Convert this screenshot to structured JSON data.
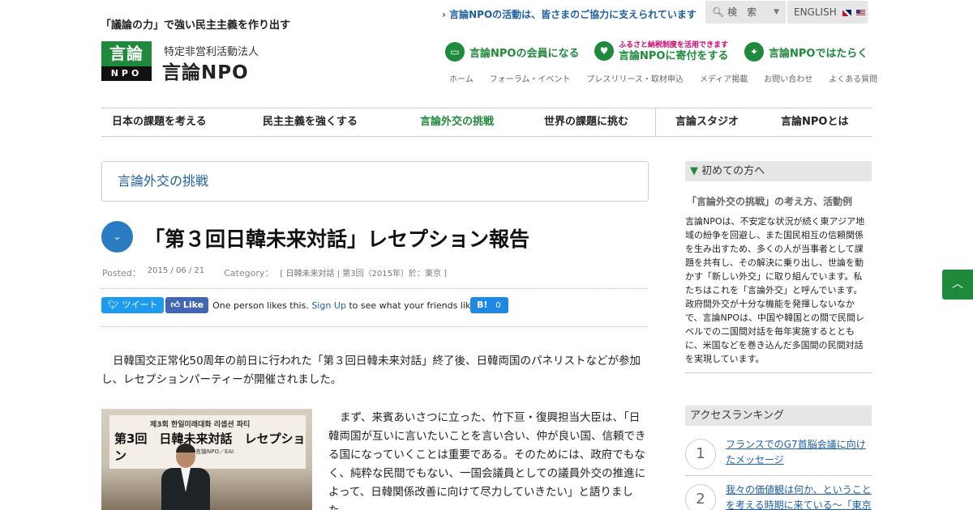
{
  "header": {
    "tagline": "「議論の力」で強い民主主義を作り出す",
    "logo_big": "言論",
    "logo_small": "NPO",
    "org_sub": "特定非営利活動法人",
    "org_name": "言論NPO",
    "support_text": "言論NPOの活動は、皆さまのご協力に支えられています",
    "search_label": "検　索",
    "lang_label": "ENGLISH",
    "actions": [
      {
        "label": "言論NPOの会員になる",
        "icon": "member-card-icon"
      },
      {
        "tiny": "ふるさと納税制度を活用できます",
        "label": "言論NPOに寄付をする",
        "icon": "heart-icon"
      },
      {
        "label": "言論NPOではたらく",
        "icon": "runner-icon"
      }
    ],
    "utility_links": [
      "ホーム",
      "フォーラム・イベント",
      "プレスリリース・取材申込",
      "メディア掲載",
      "お問い合わせ",
      "よくある質問"
    ]
  },
  "nav": {
    "items": [
      "日本の課題を考える",
      "民主主義を強くする",
      "言論外交の挑戦",
      "世界の課題に挑む",
      "言論スタジオ",
      "言論NPOとは"
    ],
    "active": "言論外交の挑戦"
  },
  "main": {
    "breadcrumb": "言論外交の挑戦",
    "title": "「第３回日韓未来対話」レセプション報告",
    "posted_label": "Posted：",
    "posted_value": "2015 / 06 / 21",
    "category_label": "Category：",
    "category_value": "[ 日韓未来対話 |  第3回（2015年）於：東京 ]",
    "tweet_label": "ツイート",
    "like_label": "Like",
    "fb_text": "One person likes this.",
    "fb_signup": "Sign Up",
    "fb_text2": "to see what your friends like.",
    "hatena_label": "B!",
    "hatena_count": "0",
    "para1": "日韓国交正常化50周年の前日に行われた「第３回日韓未来対話」終了後、日韓両国のパネリストなどが参加し、レセプションパーティーが開催されました。",
    "para2": "まず、来賓あいさつに立った、竹下亘・復興担当大臣は、「日韓両国が互いに言いたいことを言い合い、仲が良い国、信頼できる国になっていくことは重要である。そのためには、政府でもなく、純粋な民間でもない、一国会議員としての議員外交の推進によって、日韓関係改善に向けて尽力していきたい」と語りました。",
    "photo_banner_top": "제3회 한일미래대화 리셉션 파티",
    "photo_banner_main": "第3回　日韓未来対話　レセプション",
    "photo_banner_sub": "主催　言論NPO／EAI"
  },
  "sidebar": {
    "intro_heading": "初めての方へ",
    "intro_sub": "「言論外交の挑戦」の考え方、活動例",
    "intro_text": "言論NPOは、不安定な状況が続く東アジア地域の紛争を回避し、また国民相互の信頼関係を生み出すため、多くの人が当事者として課題を共有し、その解決に乗り出し、世論を動かす「新しい外交」に取り組んでいます。私たちはこれを「言論外交」と呼んでいます。政府間外交が十分な機能を発揮しないなかで、言論NPOは、中国や韓国との間で民間レベルでの二国間対話を毎年実施するとともに、米国などを巻き込んだ多国間の民間対話を実現しています。",
    "ranking_heading": "アクセスランキング",
    "ranking": [
      {
        "num": "1",
        "title": "フランスでのG7首脳会議に向けたメッセージ"
      },
      {
        "num": "2",
        "title": "我々の価値観は何か、ということを考える時期に来ている～「東京"
      }
    ]
  },
  "colors": {
    "brand_green": "#1f8a3c",
    "link_blue": "#1e5fa8",
    "accent_pink": "#d2006e"
  }
}
